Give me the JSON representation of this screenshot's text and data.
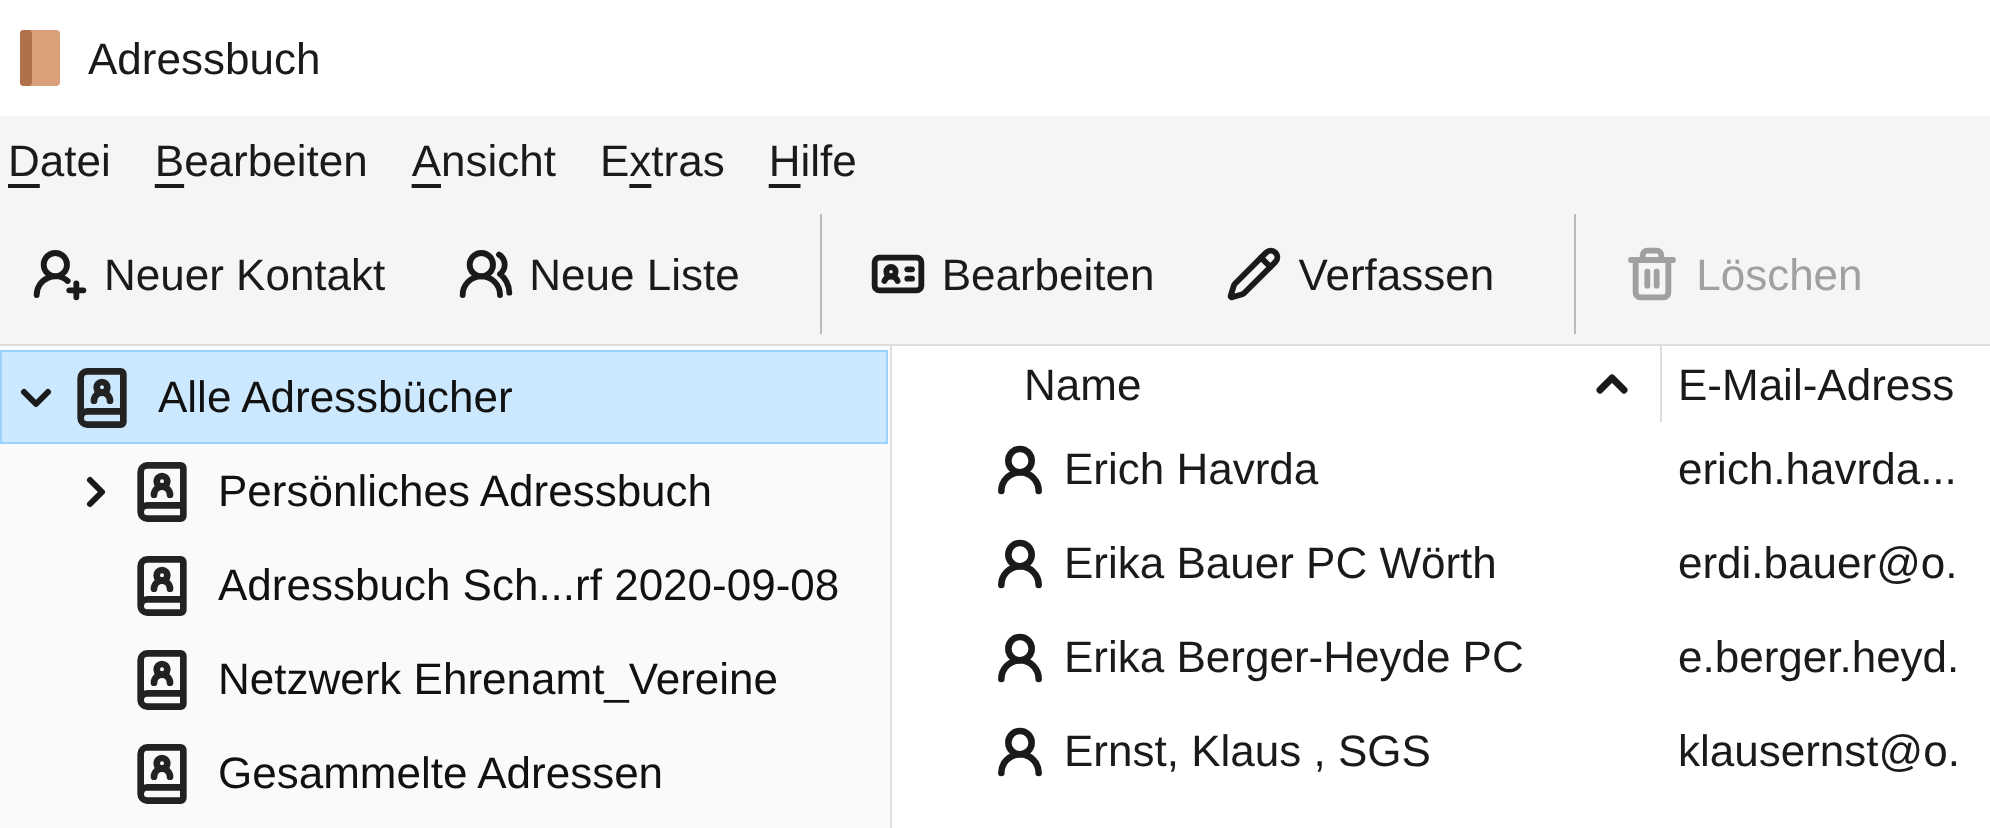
{
  "window": {
    "title": "Adressbuch"
  },
  "menu": [
    {
      "parts": [
        {
          "text": "D",
          "underlined": true
        },
        {
          "text": "atei",
          "underlined": false
        }
      ]
    },
    {
      "parts": [
        {
          "text": "B",
          "underlined": true
        },
        {
          "text": "earbeiten",
          "underlined": false
        }
      ]
    },
    {
      "parts": [
        {
          "text": "A",
          "underlined": true
        },
        {
          "text": "nsicht",
          "underlined": false
        }
      ]
    },
    {
      "parts": [
        {
          "text": "E",
          "underlined": false
        },
        {
          "text": "x",
          "underlined": true
        },
        {
          "text": "tras",
          "underlined": false
        }
      ]
    },
    {
      "parts": [
        {
          "text": "H",
          "underlined": true
        },
        {
          "text": "ilfe",
          "underlined": false
        }
      ]
    }
  ],
  "toolbar": [
    {
      "kind": "new-contact",
      "label": "Neuer Kontakt",
      "disabled": false
    },
    {
      "kind": "new-list",
      "label": "Neue Liste",
      "disabled": false
    },
    {
      "kind": "separator"
    },
    {
      "kind": "edit",
      "label": "Bearbeiten",
      "disabled": false
    },
    {
      "kind": "compose",
      "label": "Verfassen",
      "disabled": false
    },
    {
      "kind": "separator"
    },
    {
      "kind": "delete",
      "label": "Löschen",
      "disabled": true
    }
  ],
  "tree": [
    {
      "label": "Alle Adressbücher",
      "selected": true,
      "expanded": true,
      "children": [
        {
          "label": "Persönliches Adressbuch",
          "selected": false,
          "expanded": false
        },
        {
          "label": "Adressbuch Sch...rf 2020-09-08",
          "selected": false
        },
        {
          "label": "Netzwerk Ehrenamt_Vereine",
          "selected": false
        },
        {
          "label": "Gesammelte Adressen",
          "selected": false
        }
      ]
    }
  ],
  "table": {
    "columns": [
      {
        "label": "Name",
        "sorted_ascending": true
      },
      {
        "label": "E-Mail-Adress"
      }
    ],
    "rows": [
      {
        "name": "Erich Havrda",
        "email": "erich.havrda..."
      },
      {
        "name": "Erika Bauer PC Wörth",
        "email": "erdi.bauer@o."
      },
      {
        "name": "Erika Berger-Heyde PC",
        "email": "e.berger.heyd."
      },
      {
        "name": "Ernst, Klaus , SGS",
        "email": "klausernst@o."
      }
    ]
  }
}
